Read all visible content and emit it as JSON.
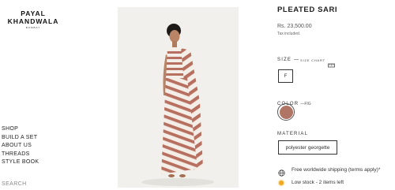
{
  "brand": {
    "line1": "PAYAL",
    "line2": "KHANDWALA",
    "subline": "BOMBAY"
  },
  "nav": {
    "items": [
      {
        "label": "SHOP"
      },
      {
        "label": "BUILD A SET"
      },
      {
        "label": "ABOUT US"
      },
      {
        "label": "THREADS"
      },
      {
        "label": "STYLE BOOK"
      }
    ],
    "search_label": "SEARCH"
  },
  "product": {
    "title": "PLEATED SARI",
    "price": "Rs. 23,500.00",
    "tax_note": "Tax included.",
    "size": {
      "label": "SIZE",
      "separator": "—",
      "chart_link": "SIZE CHART",
      "chart_icon": "ruler-icon",
      "options": [
        "F"
      ],
      "selected": "F"
    },
    "color": {
      "label": "COLOR",
      "value": "—FIG",
      "swatch_hex": "#b17565"
    },
    "material": {
      "label": "MATERIAL",
      "options": [
        "polyester georgette"
      ],
      "selected": "polyester georgette"
    },
    "shipping": {
      "icon": "globe-icon",
      "text": "Free worldwide shipping (terms apply)*"
    },
    "stock": {
      "indicator_color": "#f0a81e",
      "text": "Low stock - 2 items left"
    }
  },
  "colors": {
    "accent": "#222222",
    "photo_background": "#f1f0ec",
    "stripe_color": "#b7705f"
  }
}
